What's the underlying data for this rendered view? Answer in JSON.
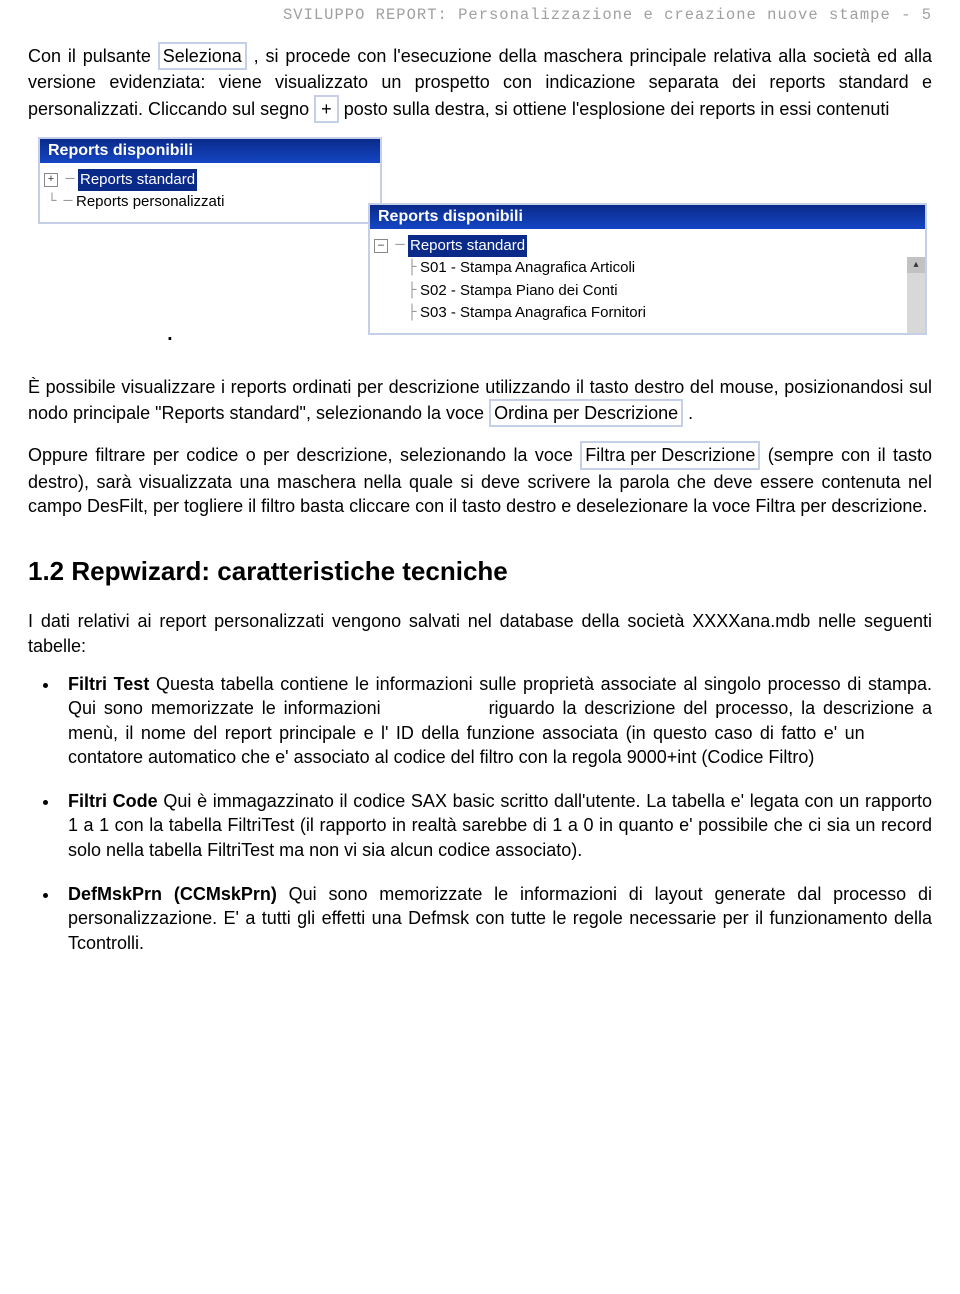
{
  "header_title": "SVILUPPO REPORT: Personalizzazione e creazione nuove stampe",
  "header_pagenum": "5",
  "p1": {
    "a": "Con il pulsante ",
    "btn": "Seleziona",
    "b": ", si procede con l'esecuzione della maschera principale relativa alla società ed alla versione evidenziata: viene visualizzato un prospetto con indicazione separata dei reports standard e personalizzati. Cliccando sul segno ",
    "plus": "+",
    "c": " posto sulla destra, si ottiene l'esplosione dei reports in essi contenuti"
  },
  "win1": {
    "title": "Reports disponibili",
    "node1": "Reports standard",
    "node2": "Reports personalizzati",
    "expand": "+"
  },
  "win2": {
    "title": "Reports disponibili",
    "node0": "Reports standard",
    "nodesub1": "S01 - Stampa Anagrafica Articoli",
    "nodesub2": "S02 - Stampa Piano dei Conti",
    "nodesub3": "S03 - Stampa Anagrafica Fornitori",
    "expand": "–"
  },
  "dot": ".",
  "p2": {
    "a": "È  possibile  visualizzare i reports ordinati per descrizione utilizzando il tasto destro del mouse, posizionandosi sul nodo principale \"Reports standard\",  selezionando la voce ",
    "btn1": "Ordina per Descrizione",
    "b": "."
  },
  "p3": {
    "a": "Oppure filtrare per codice o per descrizione, selezionando la voce ",
    "btn1": "Filtra per  Descrizione",
    "b": " (sempre con il tasto destro), sarà visualizzata una maschera nella quale si deve scrivere la parola che deve essere contenuta nel campo DesFilt, per togliere il filtro basta cliccare con il tasto destro e deselezionare la voce Filtra per descrizione."
  },
  "sec": "1.2  Repwizard: caratteristiche tecniche",
  "p4": "I dati relativi ai report personalizzati vengono salvati nel database della società XXXXana.mdb nelle seguenti tabelle:",
  "li1": {
    "name": "Filtri Test",
    "a": "   Questa tabella contiene le informazioni sulle proprietà associate al singolo processo di stampa. Qui sono memorizzate le informazioni ",
    "b": "riguardo la descrizione del processo, la descrizione a menù, il nome del report principale e l' ID della funzione associata (in questo caso di fatto e' un ",
    "c": "contatore automatico che e' associato al codice del filtro con la regola 9000+int (Codice Filtro)"
  },
  "li2": {
    "name": "Filtri Code",
    "a": "  Qui è immagazzinato il codice SAX basic scritto dall'utente. La tabella e' legata con un rapporto 1 a 1 con la tabella FiltriTest (il rapporto in realtà sarebbe di 1 a 0 in quanto e' possibile che ci sia un record solo nella tabella FiltriTest ma non vi sia alcun codice associato)."
  },
  "li3": {
    "name": "DefMskPrn (CCMskPrn)",
    "a": "  Qui sono memorizzate le informazioni di layout generate dal processo di personalizzazione. E' a tutti gli effetti una Defmsk con tutte le regole necessarie per il funzionamento della Tcontrolli."
  }
}
